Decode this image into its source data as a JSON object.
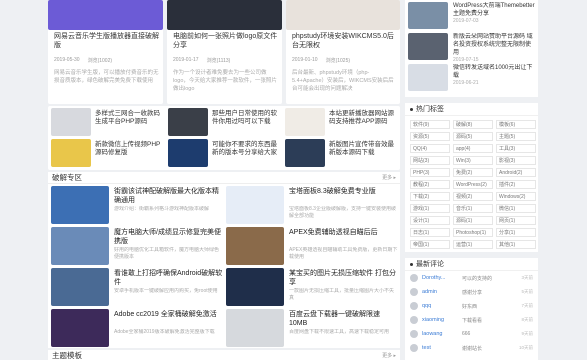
{
  "top_posts": [
    {
      "title": "网易云音乐学生版播放器直接破解版",
      "date": "2019-05-30",
      "views": "浏览(1002)",
      "desc": "网易云音乐学生版，可以播放付费音乐的无损音质版本，绿色破解完美免费下载使用",
      "color": "#6c5bd6"
    },
    {
      "title": "电脑前如何一张照片做logo原文件分享",
      "date": "2019-01-17",
      "views": "浏览(1113)",
      "desc": "作为一个设计者难免要去为一些公司做logo，今天给大家推荐一款软件，一张照片做出logo",
      "color": "#2a2f3a"
    },
    {
      "title": "phpstudy环境安装WIKCMS5.0后台无限权",
      "date": "2019-01-10",
      "views": "浏览(1025)",
      "desc": "后台最新、phpstudy环境（php-5.4+Apache）安装后，WIKCMS安装后后台可能会出现的问题解决",
      "color": "#e8e2dc"
    }
  ],
  "mini_posts": [
    {
      "title": "多样式三网合一收款码生成平台PHP源码",
      "color": "#d7d9de"
    },
    {
      "title": "那些用户日常使用的软件你用过吗可以下载",
      "color": "#3a3f48"
    },
    {
      "title": "本站更新播放器网站源码支持推荐APP源码",
      "color": "#f0ece6"
    },
    {
      "title": "新款微信上传视频PHP源码修复版",
      "color": "#e9c64a"
    },
    {
      "title": "可能你不要求的东西最新的版本号分享给大家",
      "color": "#1d3c6e"
    },
    {
      "title": "新版图片宣传带音效最新版本源码下载",
      "color": "#2c3d57"
    }
  ],
  "crack_section": {
    "title": "破解专区",
    "more": "更多",
    "items": [
      {
        "title": "街霸该试神配破解版最大化版本精确通用",
        "desc": "游戏介绍：街霸系列格斗游戏神配版本破解",
        "color": "#3c6fb4"
      },
      {
        "title": "宝塔面板8.3破解免费专业版",
        "desc": "宝塔面板8.3企业版破解版，支持一键安装使用破解全部功能",
        "color": "#e6edf7"
      },
      {
        "title": "魔方电脑大师/成绩显示修复完美便携版",
        "desc": "好用的电脑优化工具箱软件，魔方电脑大师绿色便携版本",
        "color": "#6a8bb8"
      },
      {
        "title": "APEX免费辅助透视自瞄后后",
        "desc": "APEX英雄透视自瞄辅助工具免费版，更新日期下载使用",
        "color": "#8a6a4a"
      },
      {
        "title": "看谁敢上打招呼确保Android破解软件",
        "desc": "安卓手机版本一键破解应用内购买，免root使用",
        "color": "#4a6a94"
      },
      {
        "title": "某宝买的图片无损压缩软件 打包分享",
        "desc": "一款图片无损压缩工具，批量压缩图片大小不失真",
        "color": "#1f2e4a"
      },
      {
        "title": "Adobe cc2019 全家桶破解免激活",
        "desc": "Adobe全家桶2019版本破解免激活完整版下载",
        "color": "#3d2a5a"
      },
      {
        "title": "百度云盘下载器一键破解限速10MB",
        "desc": "百度网盘下载不限速工具，高速下载稳定可用",
        "color": "#d6d9dd"
      }
    ]
  },
  "next_section": {
    "title": "主题模板",
    "more": "更多"
  },
  "sidebar_top": [
    {
      "title": "WordPress大前端Themebetter主题免费分享",
      "date": "2019-07-03",
      "color": "#7a8fa6"
    },
    {
      "title": "新版云朵网站赞助平台源码 域名投资授权系统完整无限制使用",
      "date": "2019-07-15",
      "color": "#5a6270"
    },
    {
      "title": "微信转发送域名1000元出让下载",
      "date": "2019-06-21",
      "color": "#d8dde5"
    }
  ],
  "tags_box": {
    "title": "热门标签",
    "tags": [
      "软件(9)",
      "破解(8)",
      "模板(6)",
      "资源(5)",
      "源码(5)",
      "主题(5)",
      "QQ(4)",
      "app(4)",
      "工具(3)",
      "网站(3)",
      "Win(3)",
      "影视(3)",
      "PHP(3)",
      "免费(2)",
      "Android(2)",
      "教程(2)",
      "WordPress(2)",
      "插件(2)",
      "下载(2)",
      "视频(2)",
      "Windows(2)",
      "游戏(1)",
      "音乐(1)",
      "微信(1)",
      "设计(1)",
      "源码(1)",
      "网页(1)",
      "日志(1)",
      "Photoshop(1)",
      "分享(1)",
      "帝国(1)",
      "运营(1)",
      "其他(1)"
    ]
  },
  "comments_box": {
    "title": "最新评论",
    "items": [
      {
        "name": "Dorothy...",
        "text": "可以的支持的",
        "time": "3天前"
      },
      {
        "name": "admin",
        "text": "感谢分享",
        "time": "5天前"
      },
      {
        "name": "qqq",
        "text": "好东西",
        "time": "7天前"
      },
      {
        "name": "xiaoming",
        "text": "下载看看",
        "time": "8天前"
      },
      {
        "name": "laowang",
        "text": "666",
        "time": "9天前"
      },
      {
        "name": "test",
        "text": "谢谢站长",
        "time": "10天前"
      }
    ]
  }
}
